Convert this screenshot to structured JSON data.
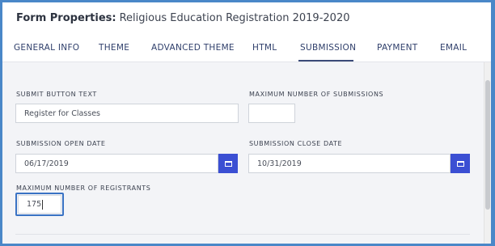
{
  "header": {
    "label": "Form Properties:",
    "form_name": "Religious Education Registration 2019-2020"
  },
  "tabs": [
    {
      "label": "GENERAL INFO"
    },
    {
      "label": "THEME"
    },
    {
      "label": "ADVANCED THEME"
    },
    {
      "label": "HTML"
    },
    {
      "label": "SUBMISSION"
    },
    {
      "label": "PAYMENT"
    },
    {
      "label": "EMAIL"
    }
  ],
  "active_tab": "SUBMISSION",
  "fields": {
    "submit_button_text": {
      "label": "SUBMIT BUTTON TEXT",
      "value": "Register for Classes"
    },
    "max_submissions": {
      "label": "MAXIMUM NUMBER OF SUBMISSIONS",
      "value": ""
    },
    "open_date": {
      "label": "SUBMISSION OPEN DATE",
      "value": "06/17/2019"
    },
    "close_date": {
      "label": "SUBMISSION CLOSE DATE",
      "value": "10/31/2019"
    },
    "max_registrants": {
      "label": "MAXIMUM NUMBER OF REGISTRANTS",
      "value": "175"
    }
  },
  "colors": {
    "accent": "#3b4fd3",
    "highlight": "#3a73c4",
    "frame": "#4a87c8"
  }
}
